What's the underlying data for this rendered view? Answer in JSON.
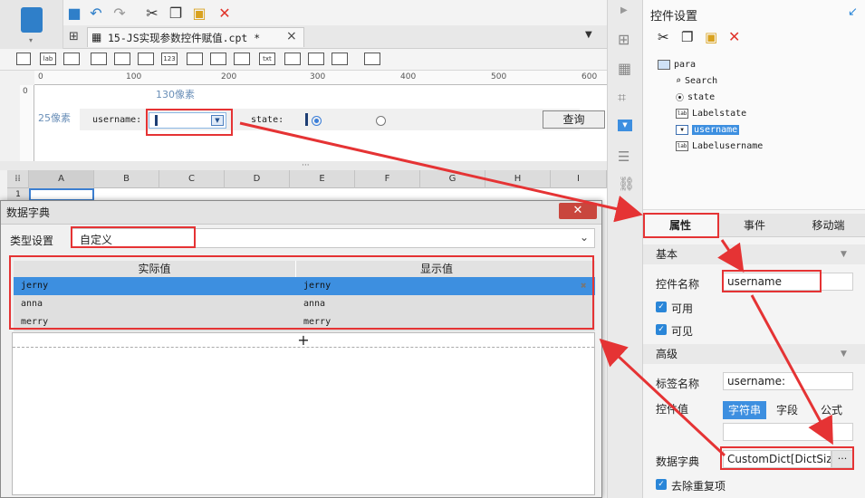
{
  "toolbar": {
    "icons": [
      "save-icon",
      "undo-icon",
      "redo-icon",
      "cut-icon",
      "copy-icon",
      "paste-icon",
      "delete-icon"
    ]
  },
  "tab": {
    "title": "15-JS实现参数控件赋值.cpt *",
    "close": "×"
  },
  "widget_bar": {
    "items": [
      "lab",
      "123",
      "txt"
    ]
  },
  "ruler": {
    "h_ticks": [
      "0",
      "100",
      "200",
      "300",
      "400",
      "500",
      "600"
    ],
    "v_ticks": [
      "0"
    ]
  },
  "param_panel": {
    "width_hint": "130像素",
    "height_hint": "25像素",
    "username_label": "username:",
    "state_label": "state:",
    "query_button": "查询"
  },
  "sheet": {
    "columns": [
      "A",
      "B",
      "C",
      "D",
      "E",
      "F",
      "G",
      "H",
      "I"
    ],
    "row_number": "1"
  },
  "dialog": {
    "title": "数据字典",
    "close": "✕",
    "type_label": "类型设置",
    "type_value": "自定义",
    "col_actual": "实际值",
    "col_display": "显示值",
    "rows": [
      {
        "actual": "jerny",
        "display": "jerny"
      },
      {
        "actual": "anna",
        "display": "anna"
      },
      {
        "actual": "merry",
        "display": "merry"
      }
    ],
    "add": "+"
  },
  "right_panel": {
    "title": "控件设置",
    "tree": [
      {
        "icon": "para",
        "label": "para"
      },
      {
        "icon": "search",
        "label": "Search"
      },
      {
        "icon": "radio",
        "label": "state"
      },
      {
        "icon": "lab",
        "label": "Labelstate"
      },
      {
        "icon": "combo",
        "label": "username"
      },
      {
        "icon": "lab",
        "label": "Labelusername"
      }
    ],
    "tabs": [
      "属性",
      "事件",
      "移动端"
    ],
    "basic_section": "基本",
    "control_name_label": "控件名称",
    "control_name_value": "username",
    "enabled_label": "可用",
    "visible_label": "可见",
    "advanced_section": "高级",
    "tag_name_label": "标签名称",
    "tag_name_value": "username:",
    "control_value_label": "控件值",
    "value_types": [
      "字符串",
      "字段",
      "公式"
    ],
    "dict_label": "数据字典",
    "dict_value": "CustomDict[DictSize:",
    "dict_more": "···",
    "dedupe_label": "去除重复项"
  },
  "colors": {
    "accent": "#3399ee",
    "highlight": "#e53334",
    "selected_row": "#3d8fe0"
  }
}
